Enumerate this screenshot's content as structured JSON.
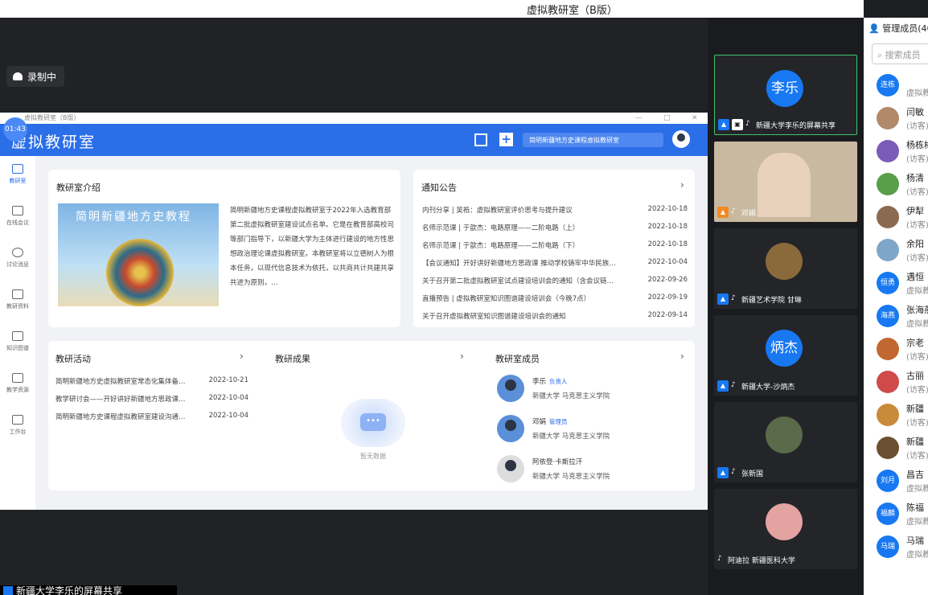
{
  "window": {
    "title": "虚拟教研室（B版）"
  },
  "recording": {
    "label": "录制中"
  },
  "timer": "01:43",
  "app": {
    "winbar_title": "虚拟教研室（B版）",
    "logo": "虚拟教研室",
    "room_select": "简明新疆地方史课程虚拟教研室",
    "nav": [
      {
        "label": "教研室",
        "icon": "book-icon"
      },
      {
        "label": "在线会议",
        "icon": "camera-icon"
      },
      {
        "label": "讨论消息",
        "icon": "chat-icon"
      },
      {
        "label": "教研资料",
        "icon": "folder-icon"
      },
      {
        "label": "知识图谱",
        "icon": "graph-icon"
      },
      {
        "label": "教学资源",
        "icon": "doc-icon"
      },
      {
        "label": "工作台",
        "icon": "desk-icon"
      }
    ],
    "intro": {
      "title": "教研室介绍",
      "book_title": "简明新疆地方史教程",
      "text": "简明新疆地方史课程虚拟教研室于2022年入选教育部第二批虚拟教研室建设试点名单。它是在教育部高校司等部门指导下，以新疆大学为主体进行建设的地方性思想政治理论课虚拟教研室。本教研室将以立德树人为根本任务，以现代信息技术为依托，以共商共计共建共享共进为原则，…"
    },
    "notice": {
      "title": "通知公告",
      "items": [
        {
          "text": "内刊分享 | 吴祇：虚拟教研室评价思考与提升建议",
          "date": "2022-10-18"
        },
        {
          "text": "名师示范课 | 于歆杰：电路原理——二阶电路（上）",
          "date": "2022-10-18"
        },
        {
          "text": "名师示范课 | 于歆杰：电路原理——二阶电路（下）",
          "date": "2022-10-18"
        },
        {
          "text": "【会议通知】开好讲好新疆地方思政课 推动学校铸牢中华民族…",
          "date": "2022-10-04"
        },
        {
          "text": "关于召开第二批虚拟教研室试点建设培训会的通知（含会议链…",
          "date": "2022-09-26"
        },
        {
          "text": "直播预告 | 虚拟教研室知识图谱建设培训会（今晚7点）",
          "date": "2022-09-19"
        },
        {
          "text": "关于召开虚拟教研室知识图谱建设培训会的通知",
          "date": "2022-09-14"
        }
      ]
    },
    "activities": {
      "title": "教研活动",
      "items": [
        {
          "text": "简明新疆地方史虚拟教研室常态化集体备…",
          "date": "2022-10-21"
        },
        {
          "text": "教学研讨会——开好讲好新疆地方思政课…",
          "date": "2022-10-04"
        },
        {
          "text": "简明新疆地方史课程虚拟教研室建设沟通…",
          "date": "2022-10-04"
        }
      ]
    },
    "results": {
      "title": "教研成果",
      "empty": "暂无数据"
    },
    "members": {
      "title": "教研室成员",
      "items": [
        {
          "name": "李乐",
          "role": "负责人",
          "org": "新疆大学 马克思主义学院"
        },
        {
          "name": "邓娟",
          "role": "管理员",
          "org": "新疆大学 马克思主义学院"
        },
        {
          "name": "阿依登·卡斯拉汗",
          "role": "",
          "org": "新疆大学 马克思主义学院"
        }
      ]
    }
  },
  "videos": [
    {
      "type": "avatar",
      "initials": "李乐",
      "caption": "新疆大学李乐的屏幕共享",
      "active": true
    },
    {
      "type": "photo",
      "caption": "邓娟",
      "active": false
    },
    {
      "type": "photo",
      "caption": "新疆艺术学院 甘琳",
      "active": false
    },
    {
      "type": "avatar",
      "initials": "炳杰",
      "caption": "新疆大学-沙炳杰",
      "active": false
    },
    {
      "type": "photo",
      "caption": "张新国",
      "active": false
    },
    {
      "type": "photo",
      "caption": "阿迪拉 新疆医科大学",
      "active": false
    }
  ],
  "panel": {
    "title": "管理成员(46)",
    "search_placeholder": "搜索成员",
    "members": [
      {
        "name": "",
        "sub": "虚拟教",
        "avatar": "连栋",
        "color": "#1778f2"
      },
      {
        "name": "闫敏",
        "sub": "(访客)",
        "avatar": "",
        "color": "#b08a6a"
      },
      {
        "name": "杨栋梅",
        "sub": "(访客)",
        "avatar": "",
        "color": "#7a5cb8"
      },
      {
        "name": "杨清",
        "sub": "(访客)",
        "avatar": "",
        "color": "#5b9e4a"
      },
      {
        "name": "伊犁",
        "sub": "(访客)",
        "avatar": "",
        "color": "#8a6a50"
      },
      {
        "name": "余阳",
        "sub": "(访客)",
        "avatar": "",
        "color": "#7fa6c8"
      },
      {
        "name": "遇恒",
        "sub": "虚拟教",
        "avatar": "恒勇",
        "color": "#1778f2"
      },
      {
        "name": "张海燕",
        "sub": "虚拟教",
        "avatar": "海燕",
        "color": "#1778f2"
      },
      {
        "name": "宗老",
        "sub": "(访客)",
        "avatar": "",
        "color": "#c0682f"
      },
      {
        "name": "古丽",
        "sub": "(访客)",
        "avatar": "",
        "color": "#d04a4a"
      },
      {
        "name": "新疆",
        "sub": "(访客)",
        "avatar": "",
        "color": "#c98a3a"
      },
      {
        "name": "新疆",
        "sub": "(访客)",
        "avatar": "",
        "color": "#6a5030"
      },
      {
        "name": "昌吉",
        "sub": "虚拟教",
        "avatar": "刘月",
        "color": "#1778f2"
      },
      {
        "name": "陈福",
        "sub": "虚拟教",
        "avatar": "福麟",
        "color": "#1778f2"
      },
      {
        "name": "马瑞",
        "sub": "虚拟教",
        "avatar": "马瑞",
        "color": "#1778f2"
      }
    ]
  },
  "bottom_caption": "新疆大学李乐的屏幕共享"
}
